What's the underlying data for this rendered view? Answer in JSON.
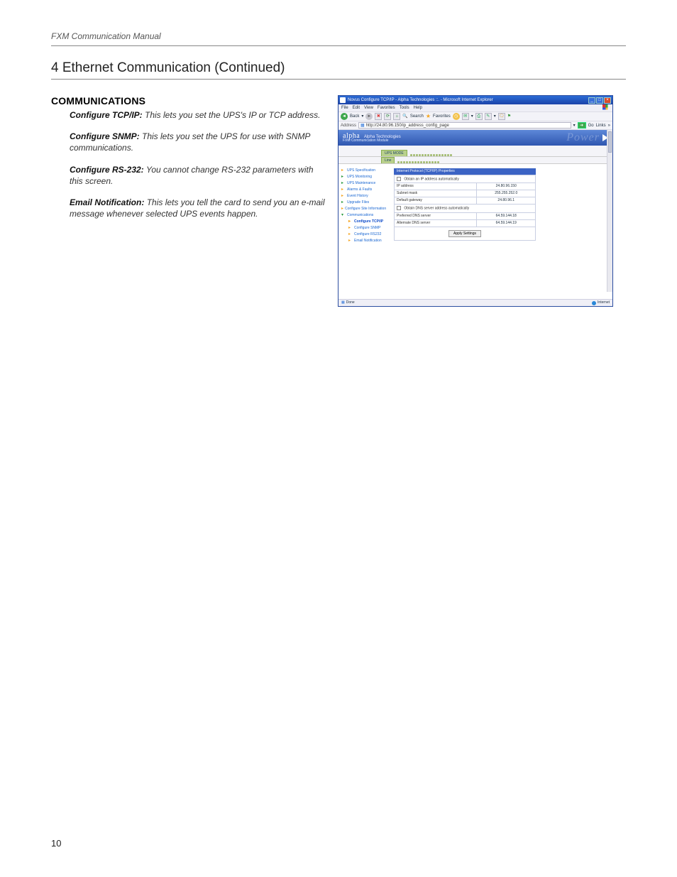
{
  "header_label": "FXM Communication Manual",
  "section_title": "4 Ethernet Communication (Continued)",
  "page_number": "10",
  "communications": {
    "heading": "COMMUNICATIONS",
    "items": [
      {
        "label": "Configure TCP/IP:",
        "text": "This lets you set the UPS's IP or TCP address."
      },
      {
        "label": "Configure SNMP:",
        "text": "This lets you set the UPS for use with SNMP communications."
      },
      {
        "label": "Configure RS-232:",
        "text": "You cannot change RS-232 parameters with this screen."
      },
      {
        "label": "Email Notification:",
        "text": "This lets you tell the card to send you an e-mail message whenever selected UPS events happen."
      }
    ]
  },
  "screenshot": {
    "window_title": "Novus Configure TCP/IP - Alpha Technologies ::. - Microsoft Internet Explorer",
    "menubar": [
      "File",
      "Edit",
      "View",
      "Favorites",
      "Tools",
      "Help"
    ],
    "toolbar": {
      "back": "Back",
      "search": "Search",
      "favorites": "Favorites"
    },
    "addressbar": {
      "label": "Address",
      "url": "http://24.80.96.150/ip_address_config_page",
      "go": "Go",
      "links": "Links"
    },
    "brand": {
      "name": "alpha",
      "company": "Alpha Technologies",
      "sub": "FXM Communication Module",
      "watermark": "Power"
    },
    "tabs": {
      "active": "UPS MODE",
      "secondary": "Line"
    },
    "sidebar": [
      {
        "label": "UPS Specification",
        "marker": "collapsed"
      },
      {
        "label": "UPS Monitoring",
        "marker": "expand"
      },
      {
        "label": "UPS Maintenance",
        "marker": "expand"
      },
      {
        "label": "Alarms & Faults",
        "marker": "collapsed"
      },
      {
        "label": "Event History",
        "marker": "collapsed"
      },
      {
        "label": "Upgrade Files",
        "marker": "expand"
      },
      {
        "label": "Configure Site Information",
        "marker": "collapsed"
      },
      {
        "label": "Communications",
        "marker": "expanded"
      }
    ],
    "sidebar_sub": [
      {
        "label": "Configure TCP/IP",
        "selected": true
      },
      {
        "label": "Configure SNMP",
        "selected": false
      },
      {
        "label": "Configure RS232",
        "selected": false
      },
      {
        "label": "Email Notification",
        "selected": false
      }
    ],
    "panel_title": "Internet Protocol (TCP/IP) Properties",
    "auto_ip_label": "Obtain an IP address automatically",
    "rows": [
      {
        "k": "IP address",
        "v": "24.80.96.150"
      },
      {
        "k": "Subnet mask",
        "v": "255.255.252.0"
      },
      {
        "k": "Default gateway",
        "v": "24.80.96.1"
      }
    ],
    "auto_dns_label": "Obtain DNS server address automatically",
    "dns_rows": [
      {
        "k": "Preferred DNS server",
        "v": "64.59.144.18"
      },
      {
        "k": "Alternate DNS server",
        "v": "64.59.144.19"
      }
    ],
    "apply_button": "Apply Settings",
    "statusbar": {
      "left": "Done",
      "right": "Internet"
    }
  }
}
